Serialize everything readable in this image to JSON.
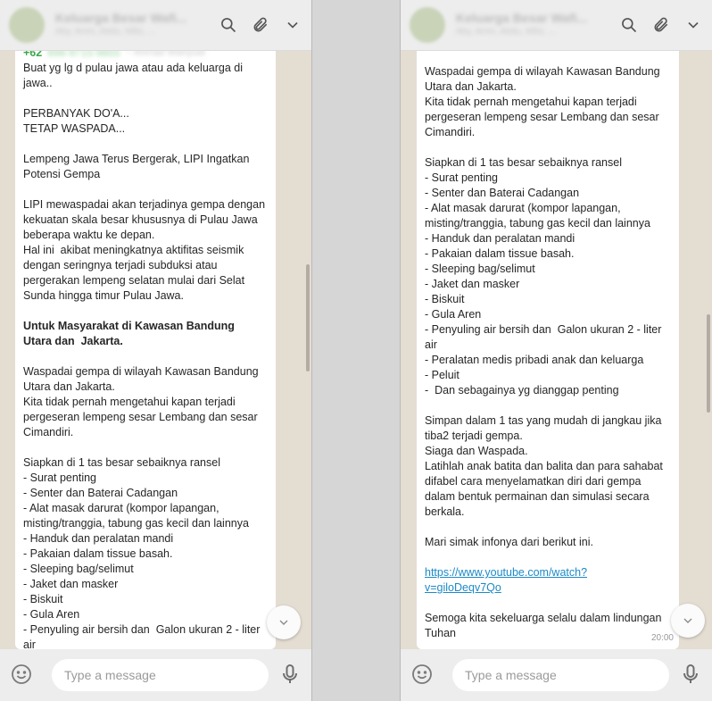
{
  "left": {
    "header": {
      "title": "Keluarga Besar Wafi...",
      "subtitle": "Aby, Amin, Abdu, Milis, ..."
    },
    "sender": {
      "number": "+62",
      "number_hidden": "898-9715-9855",
      "name_hidden": "~ Ahmad Wahyudi"
    },
    "lines": [
      {
        "t": "Buat yg lg d pulau jawa atau ada keluarga di"
      },
      {
        "t": "jawa.."
      },
      {
        "t": ""
      },
      {
        "t": "PERBANYAK DO'A..."
      },
      {
        "t": "TETAP WASPADA..."
      },
      {
        "t": ""
      },
      {
        "t": "Lempeng Jawa Terus Bergerak, LIPI Ingatkan"
      },
      {
        "t": "Potensi Gempa"
      },
      {
        "t": ""
      },
      {
        "t": "LIPI mewaspadai akan terjadinya gempa dengan"
      },
      {
        "t": "kekuatan skala besar khususnya di Pulau Jawa"
      },
      {
        "t": "beberapa waktu ke depan."
      },
      {
        "t": "Hal ini  akibat meningkatnya aktifitas seismik"
      },
      {
        "t": "dengan seringnya terjadi subduksi atau"
      },
      {
        "t": "pergerakan lempeng selatan mulai dari Selat"
      },
      {
        "t": "Sunda hingga timur Pulau Jawa."
      },
      {
        "t": ""
      },
      {
        "t": "Untuk Masyarakat di Kawasan Bandung",
        "bold": true
      },
      {
        "t": "Utara dan  Jakarta.",
        "bold": true
      },
      {
        "t": ""
      },
      {
        "t": "Waspadai gempa di wilayah Kawasan Bandung"
      },
      {
        "t": "Utara dan Jakarta."
      },
      {
        "t": "Kita tidak pernah mengetahui kapan terjadi"
      },
      {
        "t": "pergeseran lempeng sesar Lembang dan sesar"
      },
      {
        "t": "Cimandiri."
      },
      {
        "t": ""
      },
      {
        "t": "Siapkan di 1 tas besar sebaiknya ransel"
      },
      {
        "t": "- Surat penting"
      },
      {
        "t": "- Senter dan Baterai Cadangan"
      },
      {
        "t": "- Alat masak darurat (kompor lapangan,"
      },
      {
        "t": "misting/tranggia, tabung gas kecil dan lainnya"
      },
      {
        "t": "- Handuk dan peralatan mandi"
      },
      {
        "t": "- Pakaian dalam tissue basah."
      },
      {
        "t": "- Sleeping bag/selimut"
      },
      {
        "t": "- Jaket dan masker"
      },
      {
        "t": "- Biskuit"
      },
      {
        "t": "- Gula Aren"
      },
      {
        "t": "- Penyuling air bersih dan  Galon ukuran 2 - liter"
      },
      {
        "t": "air"
      }
    ],
    "footer": {
      "placeholder": "Type a message"
    }
  },
  "right": {
    "header": {
      "title": "Keluarga Besar Wafi...",
      "subtitle": "Aby, Amin, Abdu, Milis, ..."
    },
    "lines": [
      {
        "t": "Utara dan  Jakarta.",
        "bold": true
      },
      {
        "t": ""
      },
      {
        "t": "Waspadai gempa di wilayah Kawasan Bandung"
      },
      {
        "t": "Utara dan Jakarta."
      },
      {
        "t": "Kita tidak pernah mengetahui kapan terjadi"
      },
      {
        "t": "pergeseran lempeng sesar Lembang dan sesar"
      },
      {
        "t": "Cimandiri."
      },
      {
        "t": ""
      },
      {
        "t": "Siapkan di 1 tas besar sebaiknya ransel"
      },
      {
        "t": "- Surat penting"
      },
      {
        "t": "- Senter dan Baterai Cadangan"
      },
      {
        "t": "- Alat masak darurat (kompor lapangan,"
      },
      {
        "t": "misting/tranggia, tabung gas kecil dan lainnya"
      },
      {
        "t": "- Handuk dan peralatan mandi"
      },
      {
        "t": "- Pakaian dalam tissue basah."
      },
      {
        "t": "- Sleeping bag/selimut"
      },
      {
        "t": "- Jaket dan masker"
      },
      {
        "t": "- Biskuit"
      },
      {
        "t": "- Gula Aren"
      },
      {
        "t": "- Penyuling air bersih dan  Galon ukuran 2 - liter"
      },
      {
        "t": "air"
      },
      {
        "t": "- Peralatan medis pribadi anak dan keluarga"
      },
      {
        "t": "- Peluit"
      },
      {
        "t": "-  Dan sebagainya yg dianggap penting"
      },
      {
        "t": ""
      },
      {
        "t": "Simpan dalam 1 tas yang mudah di jangkau jika"
      },
      {
        "t": "tiba2 terjadi gempa."
      },
      {
        "t": "Siaga dan Waspada."
      },
      {
        "t": "Latihlah anak batita dan balita dan para sahabat"
      },
      {
        "t": "difabel cara menyelamatkan diri dari gempa"
      },
      {
        "t": "dalam bentuk permainan dan simulasi secara"
      },
      {
        "t": "berkala."
      },
      {
        "t": ""
      },
      {
        "t": "Mari simak infonya dari berikut ini."
      },
      {
        "t": ""
      },
      {
        "t": "https://www.youtube.com/watch?",
        "link": true
      },
      {
        "t": "v=giloDeqv7Qo",
        "link": true
      },
      {
        "t": ""
      },
      {
        "t": "Semoga kita sekeluarga selalu dalam lindungan"
      },
      {
        "t": "Tuhan"
      }
    ],
    "time": "20:00",
    "footer": {
      "placeholder": "Type a message"
    }
  },
  "icons": {
    "search": "search-icon",
    "attach": "paperclip-icon",
    "menu": "chevron-down-icon",
    "emoji": "emoji-icon",
    "mic": "microphone-icon",
    "scroll": "chevron-down-icon"
  }
}
